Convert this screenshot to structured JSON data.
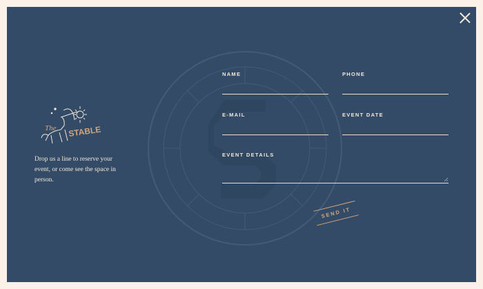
{
  "colors": {
    "page_bg": "#fbf1e8",
    "modal_bg": "#334b66",
    "text": "#f1e8dc",
    "accent": "#d1a57c"
  },
  "logo": {
    "word_the": "The",
    "word_stable": "STABLE"
  },
  "intro_text": "Drop us a line to reserve your event, or come see the space in person.",
  "form": {
    "name_label": "NAME",
    "phone_label": "PHONE",
    "email_label": "E-MAIL",
    "event_date_label": "EVENT DATE",
    "event_details_label": "EVENT DETAILS",
    "name_value": "",
    "phone_value": "",
    "email_value": "",
    "event_date_value": "",
    "event_details_value": ""
  },
  "send_label": "SEND IT",
  "icons": {
    "close": "close-icon",
    "logo": "archer-centaur-logo",
    "watermark": "stable-emblem-watermark"
  }
}
